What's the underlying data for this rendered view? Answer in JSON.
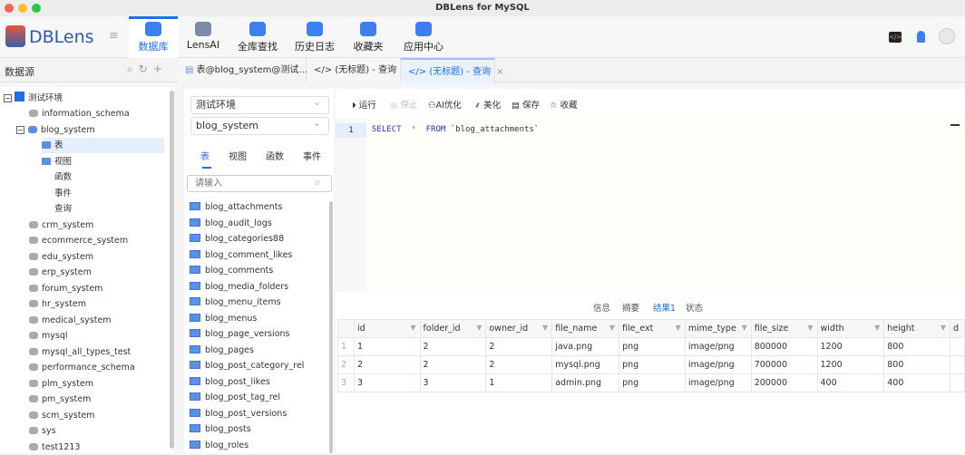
{
  "window": {
    "title": "DBLens for MySQL"
  },
  "brand": {
    "name": "DBLens"
  },
  "nav": [
    {
      "label": "数据库"
    },
    {
      "label": "LensAI"
    },
    {
      "label": "全库查找"
    },
    {
      "label": "历史日志"
    },
    {
      "label": "收藏夹"
    },
    {
      "label": "应用中心"
    }
  ],
  "sidebar": {
    "title": "数据源",
    "root": "测试环境",
    "items": [
      "information_schema",
      "blog_system",
      "表",
      "视图",
      "函数",
      "事件",
      "查询",
      "crm_system",
      "ecommerce_system",
      "edu_system",
      "erp_system",
      "forum_system",
      "hr_system",
      "medical_system",
      "mysql",
      "mysql_all_types_test",
      "performance_schema",
      "plm_system",
      "pm_system",
      "scm_system",
      "sys",
      "test1213"
    ]
  },
  "tabs": [
    {
      "label": "表@blog_system@测试..."
    },
    {
      "label": "(无标题) - 查询"
    },
    {
      "label": "(无标题) - 查询"
    }
  ],
  "middle": {
    "env": "测试环境",
    "db": "blog_system",
    "tabs": [
      "表",
      "视图",
      "函数",
      "事件"
    ],
    "search_placeholder": "请输入",
    "tables": [
      "blog_attachments",
      "blog_audit_logs",
      "blog_categories88",
      "blog_comment_likes",
      "blog_comments",
      "blog_media_folders",
      "blog_menu_items",
      "blog_menus",
      "blog_page_versions",
      "blog_pages",
      "blog_post_category_rel",
      "blog_post_likes",
      "blog_post_tag_rel",
      "blog_post_versions",
      "blog_posts",
      "blog_roles"
    ]
  },
  "toolbar": {
    "run": "运行",
    "stop": "停止",
    "ai": "AI优化",
    "beautify": "美化",
    "save": "保存",
    "favorite": "收藏"
  },
  "editor": {
    "line": "1",
    "kw1": "SELECT",
    "star": "*",
    "kw2": "FROM",
    "table": "`blog_attachments`"
  },
  "result_tabs": [
    "信息",
    "摘要",
    "结果1",
    "状态"
  ],
  "grid": {
    "columns": [
      "id",
      "folder_id",
      "owner_id",
      "file_name",
      "file_ext",
      "mime_type",
      "file_size",
      "width",
      "height",
      "d"
    ],
    "rows": [
      [
        "1",
        "2",
        "2",
        "java.png",
        "png",
        "image/png",
        "800000",
        "1200",
        "800",
        ""
      ],
      [
        "2",
        "2",
        "2",
        "mysql.png",
        "png",
        "image/png",
        "700000",
        "1200",
        "800",
        ""
      ],
      [
        "3",
        "3",
        "1",
        "admin.png",
        "png",
        "image/png",
        "200000",
        "400",
        "400",
        ""
      ]
    ]
  }
}
